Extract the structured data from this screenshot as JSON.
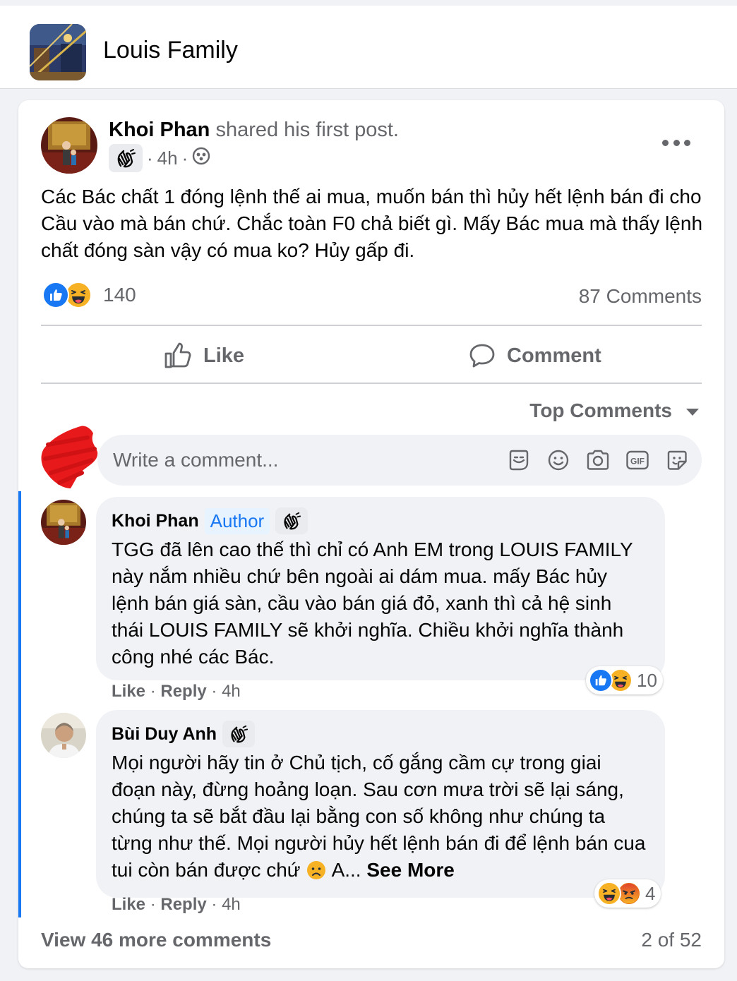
{
  "group": {
    "name": "Louis Family"
  },
  "post": {
    "author": "Khoi Phan",
    "action": "shared his first post.",
    "time": "4h",
    "text": "Các Bác chất 1 đóng lệnh thế ai mua, muốn bán thì hủy hết lệnh bán đi cho Cầu vào mà bán chứ. Chắc toàn F0 chả biết gì. Mấy Bác mua mà thấy lệnh chất đóng sàn vậy có mua ko? Hủy gấp đi.",
    "reaction_count": "140",
    "comment_count": "87 Comments",
    "like_label": "Like",
    "comment_label": "Comment"
  },
  "comments_section": {
    "sort_label": "Top Comments",
    "placeholder": "Write a comment...",
    "comments": [
      {
        "name": "Khoi Phan",
        "author_tag": "Author",
        "text": "TGG đã lên cao thế thì chỉ có Anh EM trong LOUIS FAMILY này nắm nhiều chứ bên ngoài ai dám mua. mấy Bác hủy lệnh bán giá sàn, cầu vào bán giá đỏ, xanh thì cả hệ sinh thái LOUIS FAMILY sẽ khởi nghĩa. Chiều khởi nghĩa thành công nhé các Bác.",
        "like": "Like",
        "reply": "Reply",
        "time": "4h",
        "reaction_count": "10"
      },
      {
        "name": "Bùi Duy Anh",
        "text": "Mọi người hãy tin ở Chủ tịch, cố gắng cầm cự trong giai đoạn này, đừng hoảng loạn. Sau cơn mưa trời sẽ lại sáng, chúng ta sẽ bắt đầu lại bằng con số không như chúng ta từng như thế. Mọi người hủy hết lệnh bán đi để lệnh bán cua tui còn bán được chứ",
        "text_tail": " A...",
        "see_more": "See More",
        "like": "Like",
        "reply": "Reply",
        "time": "4h",
        "reaction_count": "4"
      }
    ],
    "view_more": "View 46 more comments",
    "pager": "2 of 52"
  },
  "icons": {
    "header": [
      "group-avatar"
    ],
    "post": [
      "wave-badge-icon",
      "globe-icon",
      "more-icon",
      "like-reaction-icon",
      "haha-reaction-icon",
      "like-outline-icon",
      "comment-outline-icon"
    ],
    "composer": [
      "sticker-face-icon",
      "emoji-icon",
      "camera-icon",
      "gif-icon",
      "sticker-icon"
    ],
    "comments": [
      "sad-emoji-icon",
      "angry-reaction-icon"
    ]
  },
  "colors": {
    "accent": "#1877f2",
    "secondary_text": "#65676b",
    "bubble": "#f0f2f5",
    "haha": "#f7b125",
    "angry": "#e9710f"
  }
}
